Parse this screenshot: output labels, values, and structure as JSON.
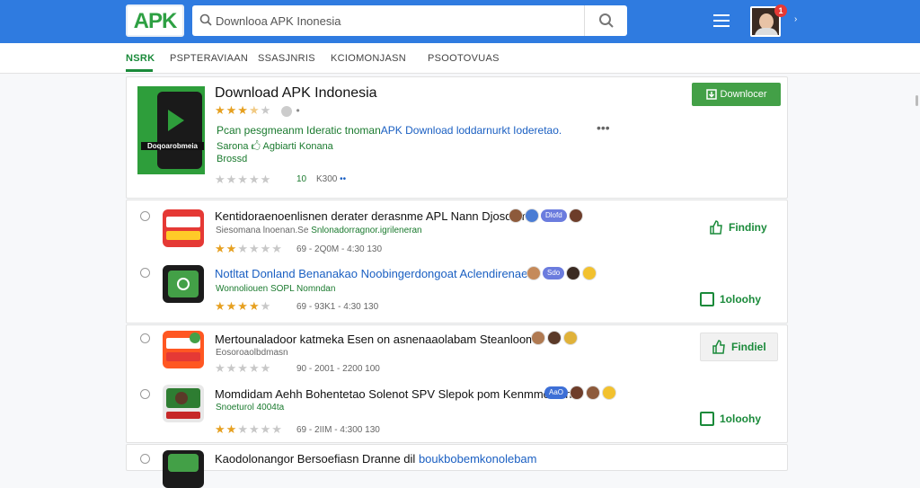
{
  "brand": {
    "logo_text": "APK",
    "accent": "#2f7be0",
    "green": "#43a047"
  },
  "search": {
    "value": "Downlooa APK Inonesia"
  },
  "user": {
    "notification_count": "1"
  },
  "tabs": [
    "NSRK",
    "PSPTERAVIAAN",
    "SSASJNRIS",
    "KCIOMONJASN",
    "PSOOTOVUAS"
  ],
  "featured": {
    "title": "Download APK Indonesia",
    "rating": 3.5,
    "thumb_caption": "Doqoarobmeia",
    "desc_green": "Pcan pesgmeanm Ideratic tnoman",
    "desc_blue": "APK Download loddarnurkt Ioderetao.",
    "more": "•••",
    "developer": "Sarona 🖒 Agbiarti Konana",
    "category": "Brossd",
    "count": "10",
    "size": "K300",
    "arrows": "••",
    "download_label": "Downlocer"
  },
  "apps": [
    {
      "title": "Kentidoraenoenlisnen derater derasnme APL Nann Djosdeme",
      "sub_gray": "Siesomana lnoenan.Se",
      "sub_green": "Snlonadorragnor.igrileneran",
      "rating": 2,
      "meta": "69  -  2Q0M  -  4:30     130",
      "pill": "Dlofd",
      "button": "Findiny",
      "boxed": false
    },
    {
      "title": "Notltat Donland Benanakao Noobingerdongoat Aclendirenae",
      "sub_gray": "",
      "sub_green": "Wonnoliouen SOPL Nomndan",
      "rating": 4,
      "meta": "69  -  93K1  -  4:30     130",
      "pill": "Sdo",
      "button": "1oloohy",
      "boxed": false
    },
    {
      "title": "Mertounaladoor katmeka Esen on asnenaaolabam Steanloom",
      "sub_gray": "Eosoroaolbdmasn",
      "sub_green": "",
      "rating": 0,
      "meta": "90  -  2001  -  2200     100",
      "pill": "",
      "button": "Findiel",
      "boxed": true
    },
    {
      "title": "Momdidam Aehh Bohentetao Solenot SPV Slepok pom Kenmmonian",
      "sub_gray": "",
      "sub_green": "Snoeturol 4004ta",
      "rating": 2,
      "meta": "69  -  2IIM  -  4:300     130",
      "pill": "AaO",
      "button": "1oloohy",
      "boxed": false
    },
    {
      "title": "Kaodolonangor Bersoefiasn Dranne dil",
      "sub_blue": "boukbobemkonolebam",
      "rating": 0,
      "meta": "",
      "pill": "",
      "button": "",
      "boxed": false
    }
  ]
}
